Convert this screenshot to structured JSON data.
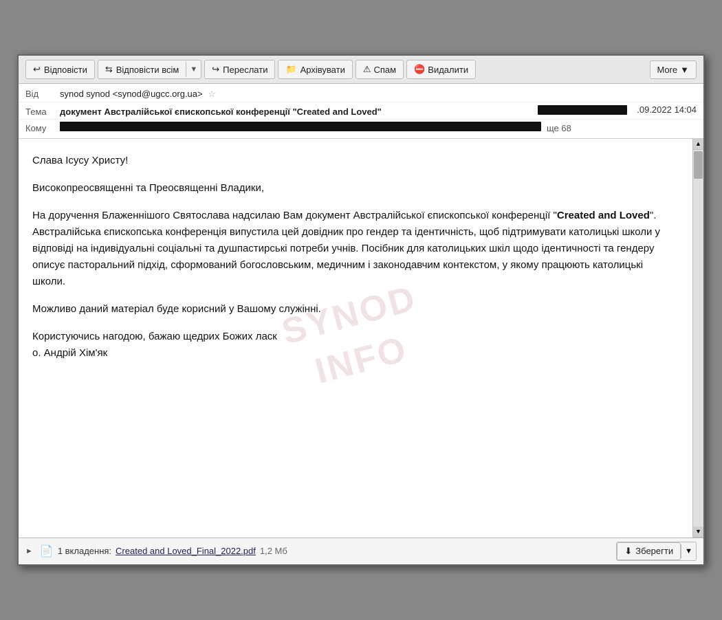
{
  "toolbar": {
    "reply_label": "Відповісти",
    "reply_all_label": "Відповісти всім",
    "forward_label": "Переслати",
    "archive_label": "Архівувати",
    "spam_label": "Спам",
    "delete_label": "Видалити",
    "more_label": "More"
  },
  "header": {
    "from_label": "Від",
    "from_value": "synod synod <synod@ugcc.org.ua>",
    "subject_label": "Тема",
    "subject_value": "документ Австралійської єпископської конференції \"Created and Loved\"",
    "date_value": ".09.2022 14:04",
    "to_label": "Кому",
    "to_extra": "ще 68"
  },
  "body": {
    "greeting": "Слава Ісусу Христу!",
    "paragraph1": "Високопреосвященні та Преосвященні Владики,",
    "paragraph2_start": "На доручення Блаженнішого Святослава надсилаю Вам документ Австралійської єпископської конференції \"",
    "paragraph2_bold": "Created and Loved",
    "paragraph2_end": "\". Австралійська єпископська конференція випустила цей довідник про гендер та ідентичність, щоб підтримувати католицькі школи у відповіді на індивідуальні соціальні та душпастирські потреби учнів. Посібник для католицьких шкіл щодо ідентичності та гендеру описує пасторальний підхід, сформований богословським, медичним і законодавчим контекстом, у якому працюють католицькі школи.",
    "paragraph3": "Можливо даний матеріал буде корисний у Вашому служінні.",
    "paragraph4_line1": "Користуючись нагодою, бажаю щедрих Божих ласк",
    "paragraph4_line2": "о. Андрій Хім'як"
  },
  "watermark": {
    "line1": "SYNOD",
    "line2": "INFO"
  },
  "attachment": {
    "count_label": "1 вкладення:",
    "filename": "Created and Loved_Final_2022.pdf",
    "size": "1,2 Мб",
    "save_label": "Зберегти"
  }
}
